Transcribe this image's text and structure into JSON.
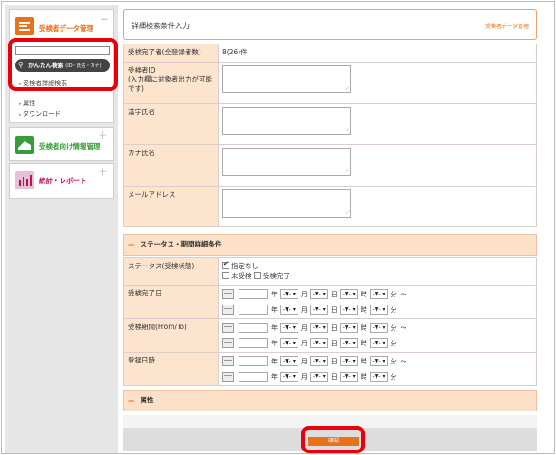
{
  "sidebar": {
    "panels": [
      {
        "title": "受検者データ管理",
        "icon": "exam-data-icon",
        "color": "#e8711c"
      },
      {
        "title": "受検者向け情報管理",
        "icon": "info-management-icon",
        "color": "#3a9b3a"
      },
      {
        "title": "統計・レポート",
        "icon": "stats-report-icon",
        "color": "#c0105a"
      }
    ],
    "easy_search_label": "かんたん検索",
    "easy_search_note": "(ID・氏名・カナ)",
    "links": [
      "受検者詳細検索",
      "属性",
      "ダウンロード"
    ],
    "collapse_symbol": "－",
    "expand_symbol": "＋"
  },
  "header": {
    "title": "詳細検索条件入力",
    "breadcrumb": "受検者データ管理"
  },
  "form": {
    "completed_label": "受検完了者(全登録者数)",
    "completed_value": "8(26)件",
    "id_label": "受検者ID\n(入力欄に対象者出力が可能です)",
    "kanji_label": "漢字氏名",
    "kana_label": "カナ氏名",
    "email_label": "メールアドレス"
  },
  "status_section": {
    "title": "ステータス・期間詳細条件",
    "status_label": "ステータス(受検状態)",
    "opt_unspecified": "指定なし",
    "opt_not_taken": "未受検",
    "opt_completed": "受検完了",
    "completed_date_label": "受検完了日",
    "period_label": "受検期間(From/To)",
    "registered_label": "登録日時",
    "year": "年",
    "month": "月",
    "day": "日",
    "hour": "時",
    "minute": "分",
    "tilde": "～",
    "select_placeholder": "-▼- ▾"
  },
  "attr_section": {
    "title": "属性"
  },
  "confirm_label": "確認",
  "colors": {
    "accent": "#e8711c",
    "label_bg": "#fde4cf",
    "highlight": "#e8000a"
  }
}
